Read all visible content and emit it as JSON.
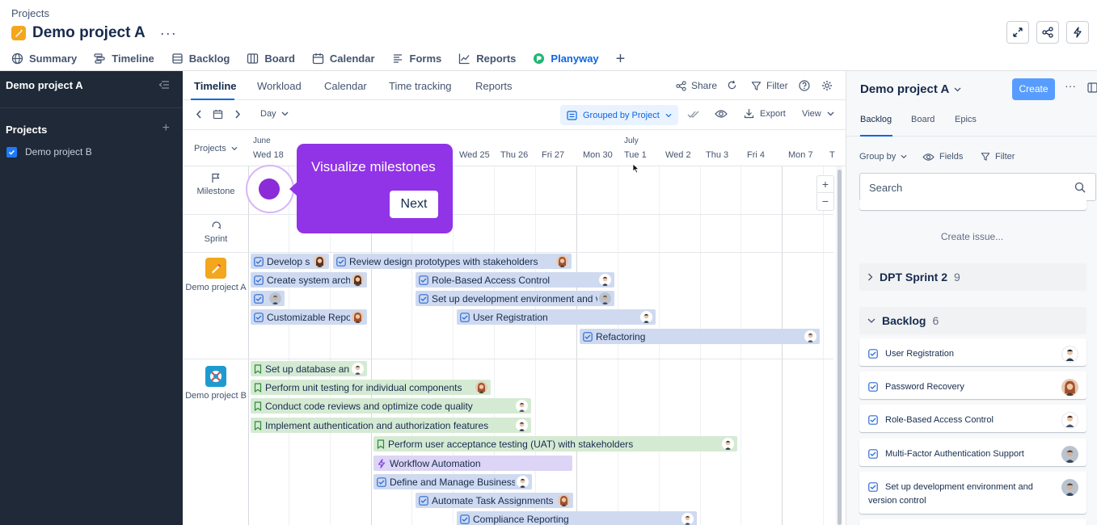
{
  "header": {
    "breadcrumb": "Projects",
    "title": "Demo project A",
    "more": "···",
    "tabs": [
      {
        "label": "Summary"
      },
      {
        "label": "Timeline"
      },
      {
        "label": "Backlog"
      },
      {
        "label": "Board"
      },
      {
        "label": "Calendar"
      },
      {
        "label": "Forms"
      },
      {
        "label": "Reports"
      },
      {
        "label": "Planyway"
      }
    ],
    "active_tab": "Planyway",
    "add_tab": "+"
  },
  "sidebar": {
    "title": "Demo project A",
    "section": "Projects",
    "add": "+",
    "items": [
      {
        "label": "Demo project B",
        "checked": true
      }
    ]
  },
  "planner": {
    "tabs": [
      "Timeline",
      "Workload",
      "Calendar",
      "Time tracking",
      "Reports"
    ],
    "active_tab": "Timeline",
    "actions": {
      "share": "Share",
      "filter": "Filter"
    },
    "toolbar": {
      "scale": "Day",
      "grouping": "Grouped by Project",
      "export": "Export",
      "view": "View"
    },
    "projects_dropdown": "Projects",
    "months": {
      "june": "June",
      "july": "July"
    },
    "dates": [
      "Wed 18",
      "Wed 25",
      "Thu 26",
      "Fri 27",
      "Mon 30",
      "Tue 1",
      "Wed 2",
      "Thu 3",
      "Fri 4",
      "Mon 7",
      "T"
    ],
    "lanes": {
      "milestone": "Milestone",
      "sprint": "Sprint",
      "project_a": "Demo project A",
      "project_b": "Demo project B"
    },
    "zoom": {
      "in": "+",
      "out": "−"
    },
    "bars": [
      {
        "text": "Develop s",
        "color": "blue",
        "icon": "checkbox"
      },
      {
        "text": "Review design prototypes with stakeholders",
        "color": "blue",
        "icon": "checkbox"
      },
      {
        "text": "Create system arch",
        "color": "blue",
        "icon": "checkbox"
      },
      {
        "text": "Role-Based Access Control",
        "color": "blue",
        "icon": "checkbox"
      },
      {
        "text": "",
        "color": "blue",
        "icon": "checkbox"
      },
      {
        "text": "Set up development environment and ve",
        "color": "blue",
        "icon": "checkbox"
      },
      {
        "text": "Customizable Repo",
        "color": "blue",
        "icon": "checkbox"
      },
      {
        "text": "User Registration",
        "color": "blue",
        "icon": "checkbox"
      },
      {
        "text": "Refactoring",
        "color": "blue",
        "icon": "checkbox"
      },
      {
        "text": "Set up database an",
        "color": "green",
        "icon": "bookmark"
      },
      {
        "text": "Perform unit testing for individual components",
        "color": "green",
        "icon": "bookmark"
      },
      {
        "text": "Conduct code reviews and optimize code quality",
        "color": "green",
        "icon": "bookmark"
      },
      {
        "text": "Implement authentication and authorization features",
        "color": "green",
        "icon": "bookmark"
      },
      {
        "text": "Perform user acceptance testing (UAT) with stakeholders",
        "color": "green",
        "icon": "bookmark"
      },
      {
        "text": "Workflow Automation",
        "color": "purple",
        "icon": "lightning"
      },
      {
        "text": "Define and Manage Business",
        "color": "blue",
        "icon": "checkbox"
      },
      {
        "text": "Automate Task Assignments",
        "color": "blue",
        "icon": "checkbox"
      },
      {
        "text": "Compliance Reporting",
        "color": "blue",
        "icon": "checkbox"
      }
    ]
  },
  "tour": {
    "text": "Visualize milestones",
    "next": "Next"
  },
  "right_panel": {
    "title": "Demo project A",
    "create": "Create",
    "more": "···",
    "tabs": [
      "Backlog",
      "Board",
      "Epics"
    ],
    "active_tab": "Backlog",
    "group_by": "Group by",
    "fields": "Fields",
    "filter": "Filter",
    "search_placeholder": "Search",
    "create_issue": "Create issue...",
    "sprint": {
      "name": "DPT Sprint 2",
      "count": "9"
    },
    "backlog": {
      "name": "Backlog",
      "count": "6"
    },
    "issues": [
      {
        "title": "User Registration"
      },
      {
        "title": "Password Recovery"
      },
      {
        "title": "Role-Based Access Control"
      },
      {
        "title": "Multi-Factor Authentication Support"
      },
      {
        "title": "Set up development environment and version control"
      }
    ]
  },
  "colors": {
    "accent": "#0c66e4",
    "sidebar_bg": "#1f2937",
    "tour": "#9133e6",
    "bar_blue": "#cfdaf0",
    "bar_green": "#d5ead3",
    "bar_purple": "#ddd5f5"
  }
}
